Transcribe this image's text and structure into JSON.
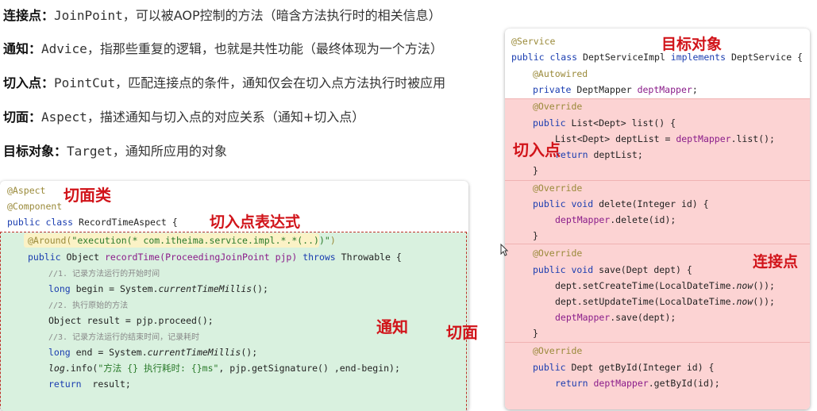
{
  "definitions": [
    {
      "term": "连接点：",
      "en": "JoinPoint",
      "desc": "，可以被AOP控制的方法（暗含方法执行时的相关信息）"
    },
    {
      "term": "通知：",
      "en": "Advice",
      "desc": "，指那些重复的逻辑，也就是共性功能（最终体现为一个方法）"
    },
    {
      "term": "切入点：",
      "en": "PointCut",
      "desc": "，匹配连接点的条件，通知仅会在切入点方法执行时被应用"
    },
    {
      "term": "切面：",
      "en": "Aspect",
      "desc": "，描述通知与切入点的对应关系（通知+切入点）"
    },
    {
      "term": "目标对象：",
      "en": "Target",
      "desc": "，通知所应用的对象"
    }
  ],
  "left_code": {
    "l1": "@Aspect",
    "l2": "@Component",
    "l3_kw": "public class ",
    "l3_rest": "RecordTimeAspect {",
    "l4_ann": "@Around(",
    "l4_str": "\"execution(* com.itheima.service.impl.*.*(..))\"",
    "l4_end": ")",
    "l5_kw": "public ",
    "l5_a": "Object ",
    "l5_b": "recordTime(ProceedingJoinPoint pjp) ",
    "l5_kw2": "throws ",
    "l5_c": "Throwable {",
    "l6": "//1. 记录方法运行的开始时间",
    "l7_kw": "long ",
    "l7_a": "begin = System.",
    "l7_it": "currentTimeMillis",
    "l7_b": "();",
    "l8": "//2. 执行原始的方法",
    "l9": "Object result = pjp.proceed();",
    "l10": "//3. 记录方法运行的结束时间，记录耗时",
    "l11_kw": "long ",
    "l11_a": "end = System.",
    "l11_it": "currentTimeMillis",
    "l11_b": "();",
    "l12_it": "log",
    "l12_a": ".info(",
    "l12_str": "\"方法 {} 执行耗时: {}ms\"",
    "l12_b": ", pjp.getSignature() ,end-begin);",
    "l13_kw": "return ",
    "l13_a": " result;"
  },
  "right_code": {
    "r1": "@Service",
    "r2_kw": "public class ",
    "r2_a": "DeptServiceImpl ",
    "r2_kw2": "implements ",
    "r2_b": "DeptService {",
    "r3": "@Autowired",
    "r4_kw": "private ",
    "r4_a": "DeptMapper ",
    "r4_f": "deptMapper",
    "r4_b": ";",
    "r5": "@Override",
    "r6_kw": "public ",
    "r6_a": "List<Dept> list() {",
    "r7_a": "List<Dept> deptList = ",
    "r7_f": "deptMapper",
    "r7_b": ".list();",
    "r8_kw": "return ",
    "r8_a": "deptList;",
    "r9": "}",
    "r10": "@Override",
    "r11_kw": "public void ",
    "r11_a": "delete(Integer id) {",
    "r12_f": "deptMapper",
    "r12_a": ".delete(id);",
    "r13": "}",
    "r14": "@Override",
    "r15_kw": "public void ",
    "r15_a": "save(Dept dept) {",
    "r16_a": "dept.setCreateTime(LocalDateTime.",
    "r16_it": "now",
    "r16_b": "());",
    "r17_a": "dept.setUpdateTime(LocalDateTime.",
    "r17_it": "now",
    "r17_b": "());",
    "r18_f": "deptMapper",
    "r18_a": ".save(dept);",
    "r19": "}",
    "r20": "@Override",
    "r21_kw": "public ",
    "r21_a": "Dept getById(Integer id) {",
    "r22_kw": "return ",
    "r22_f": "deptMapper",
    "r22_a": ".getById(id);"
  },
  "handwritten": {
    "aspect_class": "切面类",
    "pointcut_expr": "切入点表达式",
    "advice": "通知",
    "aspect": "切面",
    "target": "目标对象",
    "pointcut": "切入点",
    "joinpoint": "连接点"
  },
  "colors": {
    "annotation_red": "#d1141a",
    "joinpoint_bg": "#fcd3d3",
    "advice_bg": "#d9f1df",
    "keyword": "#1a3db0"
  }
}
